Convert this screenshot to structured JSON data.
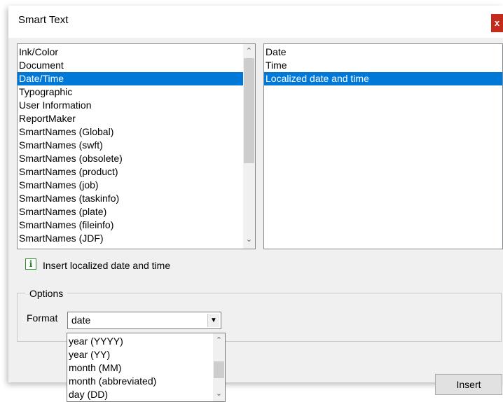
{
  "dialog": {
    "title": "Smart Text",
    "close_label": "x"
  },
  "categories": {
    "items": [
      "Ink/Color",
      "Document",
      "Date/Time",
      "Typographic",
      "User Information",
      "ReportMaker",
      "SmartNames (Global)",
      "SmartNames (swft)",
      "SmartNames (obsolete)",
      "SmartNames (product)",
      "SmartNames (job)",
      "SmartNames (taskinfo)",
      "SmartNames (plate)",
      "SmartNames (fileinfo)",
      "SmartNames (JDF)"
    ],
    "selected": "Date/Time"
  },
  "entries": {
    "items": [
      "Date",
      "Time",
      "Localized date and time"
    ],
    "selected": "Localized date and time"
  },
  "info": {
    "icon": "info-icon",
    "text": "Insert localized date and time"
  },
  "options": {
    "legend": "Options",
    "format_label": "Format",
    "format_value": "date",
    "format_options": [
      "year (YYYY)",
      "year (YY)",
      "month (MM)",
      "month (abbreviated)",
      "day (DD)"
    ]
  },
  "actions": {
    "insert_label": "Insert"
  },
  "colors": {
    "selection": "#0078d7",
    "close": "#c42b1c",
    "info_icon": "#1f7a1f"
  }
}
